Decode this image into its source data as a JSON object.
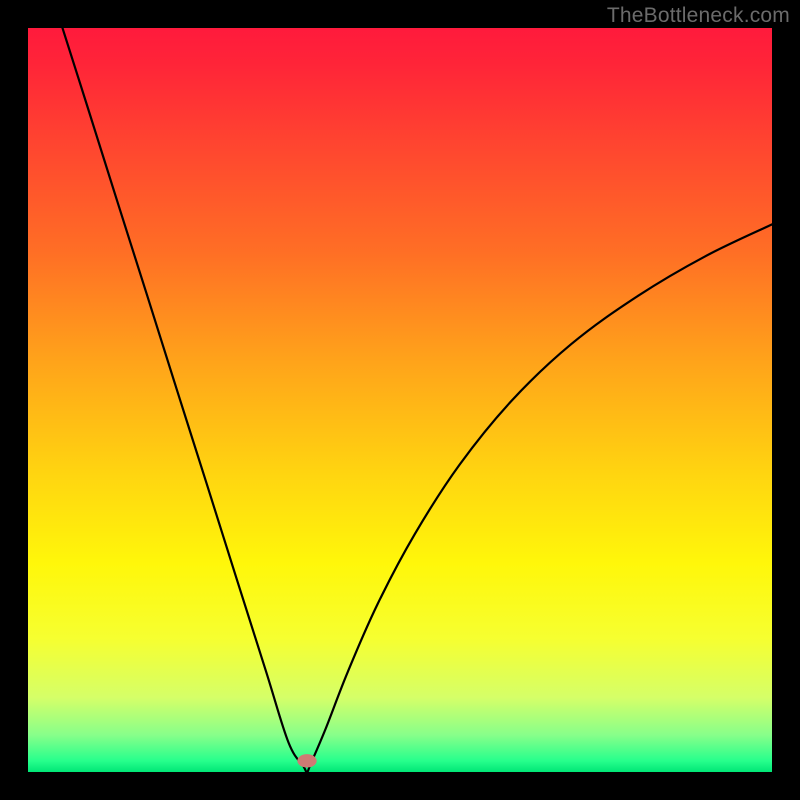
{
  "watermark": "TheBottleneck.com",
  "chart_data": {
    "type": "line",
    "title": "",
    "xlabel": "",
    "ylabel": "",
    "xlim": [
      0,
      100
    ],
    "ylim": [
      0,
      100
    ],
    "grid": false,
    "legend": false,
    "annotations": [],
    "background_gradient": {
      "stops": [
        {
          "offset": 0.0,
          "color": "#ff1a3c"
        },
        {
          "offset": 0.05,
          "color": "#ff2538"
        },
        {
          "offset": 0.15,
          "color": "#ff4330"
        },
        {
          "offset": 0.3,
          "color": "#ff6e25"
        },
        {
          "offset": 0.45,
          "color": "#ffa41a"
        },
        {
          "offset": 0.6,
          "color": "#ffd510"
        },
        {
          "offset": 0.72,
          "color": "#fff70a"
        },
        {
          "offset": 0.82,
          "color": "#f6ff30"
        },
        {
          "offset": 0.9,
          "color": "#d5ff68"
        },
        {
          "offset": 0.95,
          "color": "#88ff8a"
        },
        {
          "offset": 0.985,
          "color": "#27ff8c"
        },
        {
          "offset": 1.0,
          "color": "#00e676"
        }
      ]
    },
    "marker": {
      "x": 37.5,
      "y": 1.5,
      "color": "#cf7a74",
      "rx": 1.3,
      "ry": 0.9
    },
    "series": [
      {
        "name": "curve",
        "type": "line",
        "x": [
          4,
          8,
          12,
          16,
          20,
          24,
          28,
          32,
          35,
          37,
          37.5,
          38,
          40,
          43,
          47,
          52,
          58,
          65,
          73,
          82,
          91,
          100
        ],
        "y": [
          102,
          89.4,
          76.7,
          64.1,
          51.4,
          38.8,
          26.1,
          13.5,
          4.0,
          0.8,
          0.0,
          1.1,
          5.8,
          13.5,
          22.6,
          32.0,
          41.3,
          49.9,
          57.5,
          64.0,
          69.3,
          73.6
        ]
      }
    ]
  }
}
